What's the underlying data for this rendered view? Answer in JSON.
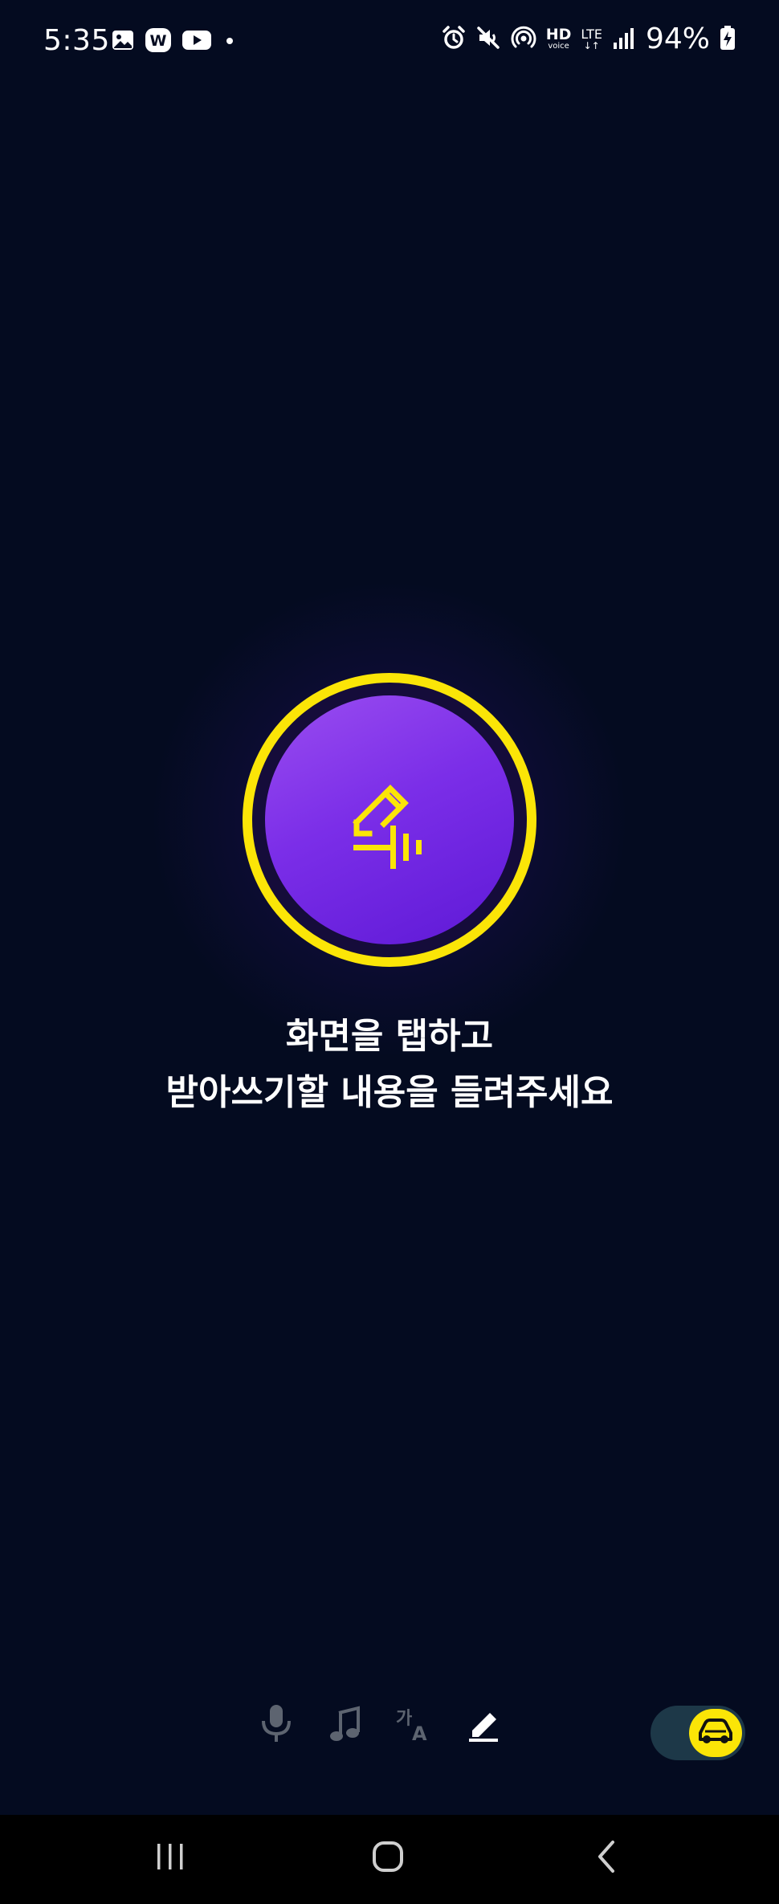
{
  "status_bar": {
    "time": "5:35",
    "left_icons": [
      "gallery-icon",
      "w-app-icon",
      "youtube-icon",
      "dot-icon"
    ],
    "right_icons": [
      "alarm-icon",
      "mute-icon",
      "hotspot-icon",
      "hd-voice-icon",
      "lte-icon",
      "signal-icon",
      "battery-charging-icon"
    ],
    "hd_label": "HD",
    "hd_sub": "voice",
    "lte_label": "LTE",
    "lte_sub": "↓↑",
    "battery": "94%"
  },
  "main": {
    "record_icon": "pen-waveform-icon",
    "instruction_line1": "화면을 탭하고",
    "instruction_line2": "받아쓰기할 내용을 들려주세요"
  },
  "mode_bar": {
    "items": [
      {
        "name": "mic-icon",
        "active": false
      },
      {
        "name": "music-note-icon",
        "active": false
      },
      {
        "name": "translate-icon",
        "active": false,
        "glyph_main": "가",
        "glyph_sub": "A"
      },
      {
        "name": "dictation-pen-icon",
        "active": true
      }
    ],
    "drive_mode_icon": "car-icon",
    "drive_mode_on": true
  },
  "nav_bar": {
    "items": [
      "recent-apps-icon",
      "home-icon",
      "back-icon"
    ]
  },
  "colors": {
    "background": "#040b20",
    "accent_yellow": "#fbe507",
    "purple": "#7b2ee8",
    "inactive_icon": "#5d6470",
    "active_icon": "#ffffff"
  }
}
